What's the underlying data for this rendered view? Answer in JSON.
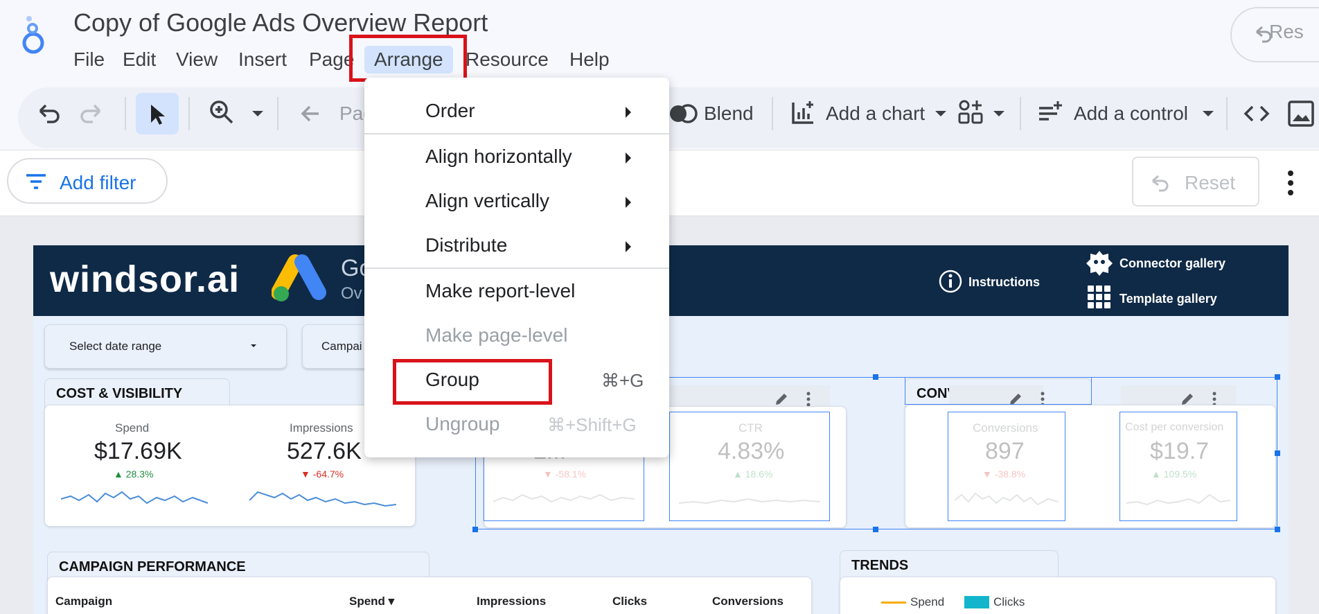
{
  "app": {
    "title": "Copy of Google Ads Overview Report",
    "top_reset_label": "Res"
  },
  "menubar": {
    "items": [
      "File",
      "Edit",
      "View",
      "Insert",
      "Page",
      "Arrange",
      "Resource",
      "Help"
    ],
    "active": "Arrange"
  },
  "toolbar": {
    "page_label": "Pag",
    "blend_label": "Blend",
    "add_chart_label": "Add a chart",
    "add_control_label": "Add a control"
  },
  "filterbar": {
    "add_filter_label": "Add filter",
    "reset_label": "Reset"
  },
  "arrange_menu": {
    "items": [
      {
        "label": "Order",
        "submenu": true,
        "enabled": true
      },
      {
        "label": "Align horizontally",
        "submenu": true,
        "enabled": true
      },
      {
        "label": "Align vertically",
        "submenu": true,
        "enabled": true
      },
      {
        "label": "Distribute",
        "submenu": true,
        "enabled": true
      },
      {
        "label": "Make report-level",
        "submenu": false,
        "enabled": true
      },
      {
        "label": "Make page-level",
        "submenu": false,
        "enabled": false
      },
      {
        "label": "Group",
        "shortcut": "⌘+G",
        "enabled": true
      },
      {
        "label": "Ungroup",
        "shortcut": "⌘+Shift+G",
        "enabled": false
      }
    ]
  },
  "report": {
    "brand": "windsor.ai",
    "banner_title_partial": "Go",
    "banner_subtitle_partial": "Ov",
    "instructions_label": "Instructions",
    "connector_gallery_label": "Connector gallery",
    "template_gallery_label": "Template gallery",
    "date_control_label": "Select date range",
    "campaign_control_label": "Campai",
    "cost_visibility": {
      "title": "COST & VISIBILITY",
      "metrics": [
        {
          "label": "Spend",
          "value": "$17.69K",
          "delta": "28.3%",
          "direction": "up"
        },
        {
          "label": "Impressions",
          "value": "527.6K",
          "delta": "-64.7%",
          "direction": "down"
        }
      ]
    },
    "engagement": {
      "metrics": [
        {
          "label": "",
          "value": "2...",
          "delta": "-58.1%",
          "direction": "down"
        },
        {
          "label": "CTR",
          "value": "4.83%",
          "delta": "18.6%",
          "direction": "up"
        }
      ]
    },
    "conversion": {
      "title": "CONVERSION",
      "metrics": [
        {
          "label": "Conversions",
          "value": "897",
          "delta": "-38.8%",
          "direction": "down"
        },
        {
          "label": "Cost per conversion",
          "value": "$19.7",
          "delta": "109.5%",
          "direction": "up"
        }
      ]
    },
    "campaign_performance": {
      "title": "CAMPAIGN PERFORMANCE",
      "columns": [
        "Campaign",
        "Spend ▾",
        "Impressions",
        "Clicks",
        "Conversions"
      ]
    },
    "trends": {
      "title": "TRENDS",
      "legend": [
        "Spend",
        "Clicks"
      ],
      "colors": {
        "spend": "#f9ab00",
        "clicks": "#12b5cb"
      }
    }
  }
}
